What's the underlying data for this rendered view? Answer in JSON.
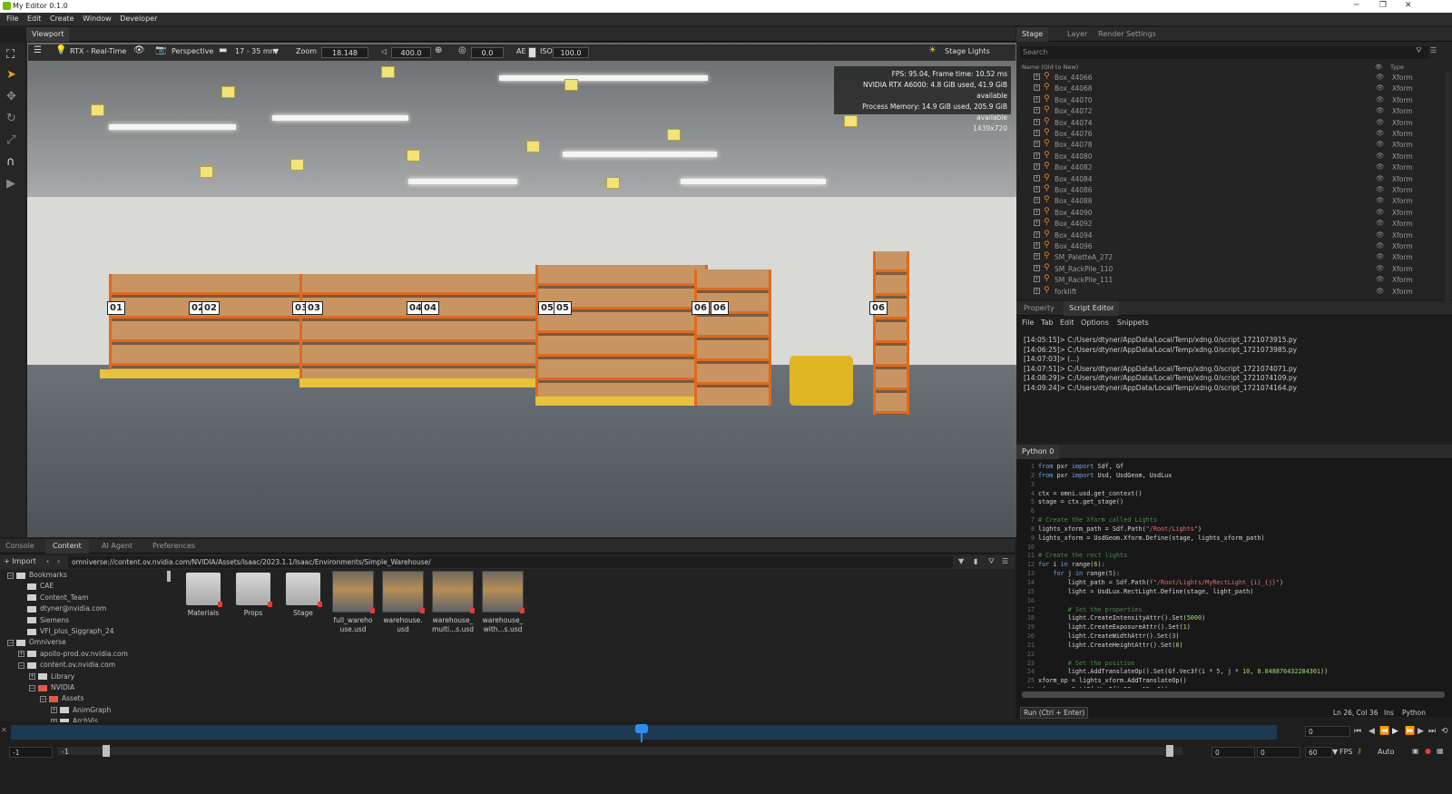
{
  "app": {
    "title": "My Editor 0.1.0",
    "menu": [
      "File",
      "Edit",
      "Create",
      "Window",
      "Developer"
    ],
    "window_controls": [
      "─",
      "❐",
      "✕"
    ]
  },
  "viewport": {
    "tab": "Viewport",
    "toolbar": {
      "renderer": "RTX - Real-Time",
      "camera": "Perspective",
      "lens": "17 - 35 mm",
      "zoom_label": "Zoom",
      "zoom_value": "18.148",
      "speed_value": "400.0",
      "exposure_value": "0.0",
      "ae_label": "AE",
      "iso_label": "ISO",
      "iso_value": "100.0",
      "stage_lights": "Stage Lights"
    },
    "stats": {
      "line1": "FPS: 95.04, Frame time: 10.52 ms",
      "line2": "NVIDIA RTX A6000: 4.8 GiB used, 41.9 GiB available",
      "line3": "Process Memory: 14.9 GiB used, 205.9 GiB available",
      "line4": "1439x720"
    },
    "rack_labels": [
      "01",
      "02",
      "02",
      "03",
      "03",
      "04",
      "04",
      "05",
      "05",
      "06",
      "06"
    ]
  },
  "stage": {
    "tabs": [
      "Stage",
      "Layer",
      "Render Settings"
    ],
    "search_placeholder": "Search",
    "col_name": "Name (Old to New)",
    "col_type": "Type",
    "rows": [
      {
        "name": "Box_44066",
        "type": "Xform"
      },
      {
        "name": "Box_44068",
        "type": "Xform"
      },
      {
        "name": "Box_44070",
        "type": "Xform"
      },
      {
        "name": "Box_44072",
        "type": "Xform"
      },
      {
        "name": "Box_44074",
        "type": "Xform"
      },
      {
        "name": "Box_44076",
        "type": "Xform"
      },
      {
        "name": "Box_44078",
        "type": "Xform"
      },
      {
        "name": "Box_44080",
        "type": "Xform"
      },
      {
        "name": "Box_44082",
        "type": "Xform"
      },
      {
        "name": "Box_44084",
        "type": "Xform"
      },
      {
        "name": "Box_44086",
        "type": "Xform"
      },
      {
        "name": "Box_44088",
        "type": "Xform"
      },
      {
        "name": "Box_44090",
        "type": "Xform"
      },
      {
        "name": "Box_44092",
        "type": "Xform"
      },
      {
        "name": "Box_44094",
        "type": "Xform"
      },
      {
        "name": "Box_44096",
        "type": "Xform"
      },
      {
        "name": "SM_PaletteA_272",
        "type": "Xform"
      },
      {
        "name": "SM_RackPile_110",
        "type": "Xform"
      },
      {
        "name": "SM_RackPile_111",
        "type": "Xform"
      },
      {
        "name": "forklift",
        "type": "Xform"
      }
    ]
  },
  "script_editor": {
    "tabs": [
      "Property",
      "Script Editor"
    ],
    "menu": [
      "File",
      "Tab",
      "Edit",
      "Options",
      "Snippets"
    ],
    "log": [
      "[14:05:15]> C:/Users/dtyner/AppData/Local/Temp/xdng.0/script_1721073915.py",
      "[14:06:25]> C:/Users/dtyner/AppData/Local/Temp/xdng.0/script_1721073985.py",
      "[14:07:03]> (...)",
      "[14:07:51]> C:/Users/dtyner/AppData/Local/Temp/xdng.0/script_1721074071.py",
      "[14:08:29]> C:/Users/dtyner/AppData/Local/Temp/xdng.0/script_1721074109.py",
      "[14:09:24]> C:/Users/dtyner/AppData/Local/Temp/xdng.0/script_1721074164.py"
    ]
  },
  "python": {
    "tab": "Python 0",
    "run_label": "Run (Ctrl + Enter)",
    "status_pos": "Ln 26, Col 36",
    "status_ins": "Ins",
    "status_lang": "Python"
  },
  "bottom": {
    "tabs": [
      "Console",
      "Content",
      "AI Agent",
      "Preferences"
    ],
    "import_label": "+ Import",
    "path": "omniverse://content.ov.nvidia.com/NVIDIA/Assets/Isaac/2023.1.1/Isaac/Environments/Simple_Warehouse/",
    "tree": [
      {
        "label": "Bookmarks",
        "level": 0,
        "toggle": "−"
      },
      {
        "label": "CAE",
        "level": 1,
        "toggle": ""
      },
      {
        "label": "Content_Team",
        "level": 1,
        "toggle": ""
      },
      {
        "label": "dtyner@nvidia.com",
        "level": 1,
        "toggle": ""
      },
      {
        "label": "Siemens",
        "level": 1,
        "toggle": ""
      },
      {
        "label": "VFI_plus_Siggraph_24",
        "level": 1,
        "toggle": ""
      },
      {
        "label": "Omniverse",
        "level": 0,
        "toggle": "−"
      },
      {
        "label": "apollo-prod.ov.nvidia.com",
        "level": 1,
        "toggle": "+"
      },
      {
        "label": "content.ov.nvidia.com",
        "level": 1,
        "toggle": "−"
      },
      {
        "label": "Library",
        "level": 2,
        "toggle": "+"
      },
      {
        "label": "NVIDIA",
        "level": 2,
        "toggle": "−"
      },
      {
        "label": "Assets",
        "level": 3,
        "toggle": "−"
      },
      {
        "label": "AnimGraph",
        "level": 4,
        "toggle": "+"
      },
      {
        "label": "ArchVis",
        "level": 4,
        "toggle": "+"
      }
    ],
    "items": [
      {
        "label": "Materials",
        "kind": "folder"
      },
      {
        "label": "Props",
        "kind": "folder"
      },
      {
        "label": "Stage",
        "kind": "folder"
      },
      {
        "label": "full_wareho use.usd",
        "kind": "thumb"
      },
      {
        "label": "warehouse. usd",
        "kind": "thumb"
      },
      {
        "label": "warehouse_ multi...s.usd",
        "kind": "thumb"
      },
      {
        "label": "warehouse_ with...s.usd",
        "kind": "thumb"
      }
    ]
  },
  "timeline": {
    "left_value": "-1",
    "start": "-1",
    "start2": "-1",
    "current": "0",
    "end_a": "0",
    "end_b": "0",
    "fps": "60",
    "fps_label": "FPS",
    "auto_label": "Auto"
  }
}
